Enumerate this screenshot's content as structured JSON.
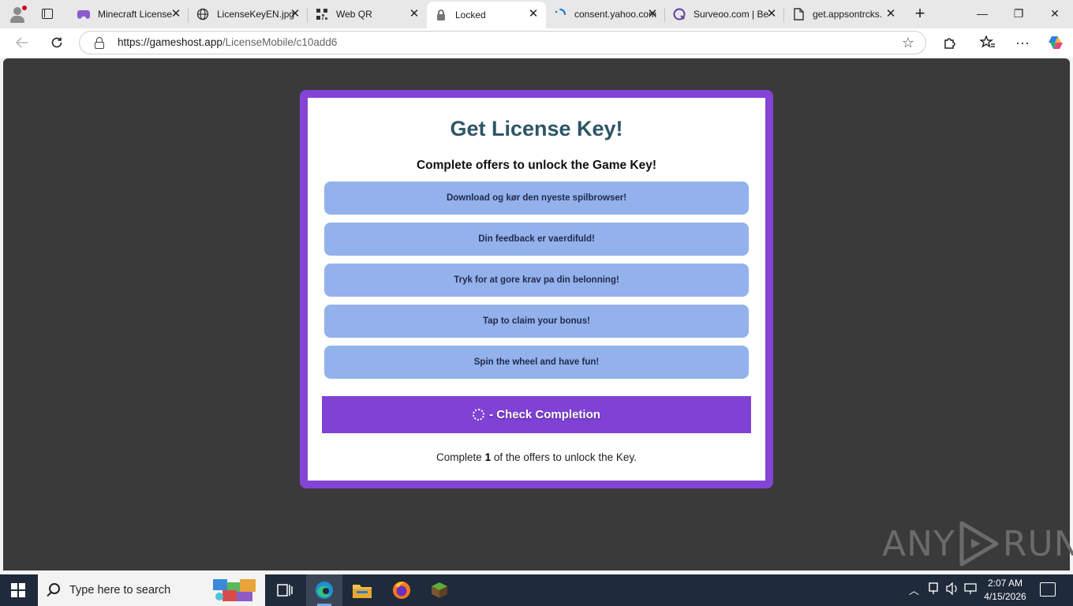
{
  "browser": {
    "tabs": [
      {
        "title": "Minecraft License",
        "icon": "controller-icon",
        "active": false
      },
      {
        "title": "LicenseKeyEN.jpg",
        "icon": "globe-icon",
        "active": false
      },
      {
        "title": "Web QR",
        "icon": "qr-icon",
        "active": false
      },
      {
        "title": "Locked",
        "icon": "lock-icon",
        "active": true
      },
      {
        "title": "consent.yahoo.com",
        "icon": "loading-icon",
        "active": false
      },
      {
        "title": "Surveoo.com | Be",
        "icon": "surveoo-icon",
        "active": false
      },
      {
        "title": "get.appsontrcks.",
        "icon": "document-icon",
        "active": false
      }
    ],
    "url_host": "https://gameshost.app",
    "url_path": "/LicenseMobile/c10add6"
  },
  "page": {
    "title": "Get License Key!",
    "subtitle": "Complete offers to unlock the Game Key!",
    "offers": [
      "Download og kør den nyeste spilbrowser!",
      "Din feedback er vaerdifuld!",
      "Tryk for at gore krav pa din belonning!",
      "Tap to claim your bonus!",
      "Spin the wheel and have fun!"
    ],
    "check_button": "- Check Completion",
    "footnote_pre": "Complete ",
    "footnote_count": "1",
    "footnote_post": " of the offers to unlock the Key.",
    "card_border_color": "#8444d6",
    "offer_color": "#93b2ec"
  },
  "watermark": {
    "left": "ANY",
    "right": "RUN"
  },
  "taskbar": {
    "search_placeholder": "Type here to search",
    "time": "2:07 AM",
    "date": "4/15/2026"
  }
}
